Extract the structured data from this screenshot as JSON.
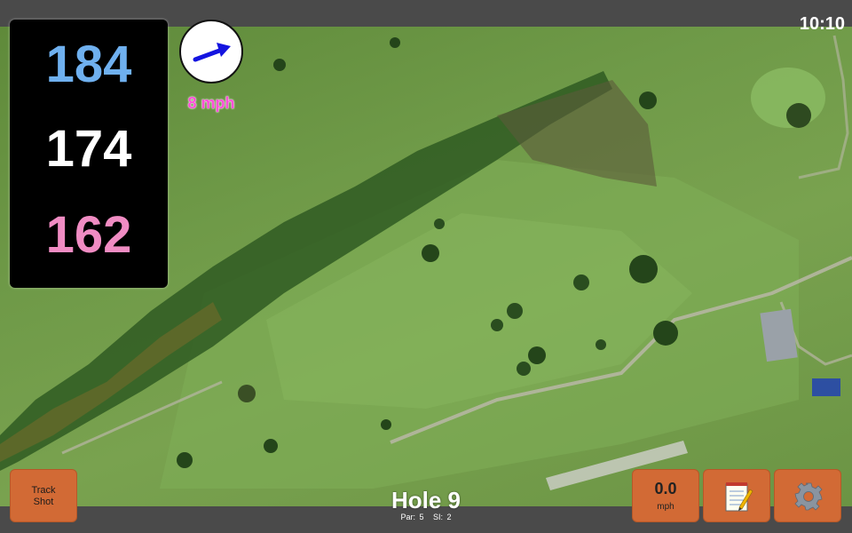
{
  "status": {
    "time": "10:10"
  },
  "distances": {
    "back": "184",
    "middle": "174",
    "front": "162"
  },
  "wind": {
    "speed_label": "8 mph",
    "icon": "wind-direction-arrow-icon"
  },
  "buttons": {
    "track_shot_line1": "Track",
    "track_shot_line2": "Shot",
    "wind_value": "0.0",
    "wind_unit": "mph",
    "notes_icon": "notepad-icon",
    "settings_icon": "gear-icon"
  },
  "hole": {
    "title": "Hole 9",
    "par": "Par: 5",
    "si": "SI: 2"
  },
  "colors": {
    "back": "#6fb0ef",
    "middle": "#ffffff",
    "front": "#f08cc3",
    "wind": "#ff4fd8",
    "button": "#d26a35"
  }
}
